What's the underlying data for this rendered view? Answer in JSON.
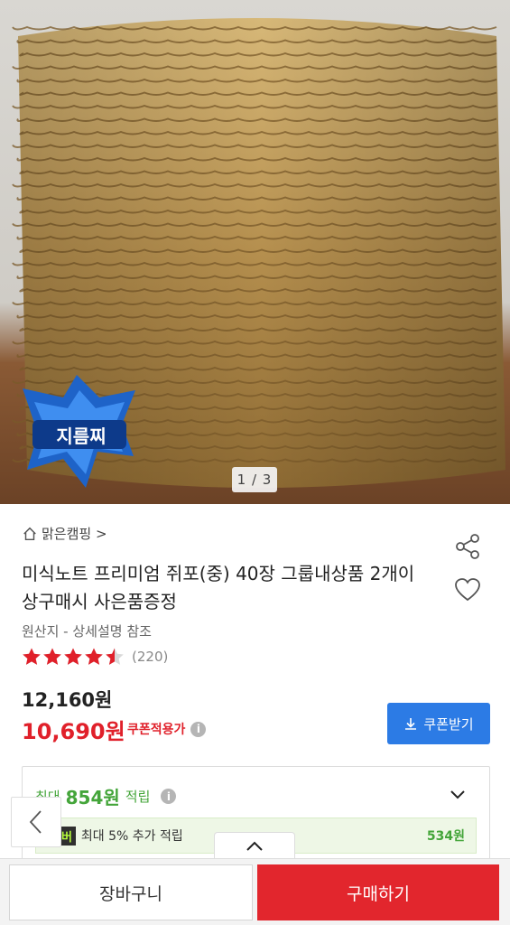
{
  "gallery": {
    "page_indicator": "1 / 3",
    "badge_text": "지름찌"
  },
  "seller": {
    "name": "맑은캠핑 >",
    "icon": "home-icon"
  },
  "product": {
    "title": "미식노트 프리미엄 쥐포(중) 40장 그룹내상품 2개이상구매시 사은품증정",
    "origin": "원산지 - 상세설명 참조",
    "rating": 4.5,
    "review_count": "(220)",
    "original_price": "12,160원",
    "sale_price": "10,690원",
    "coupon_applied_label": "쿠폰적용가"
  },
  "coupon_button": {
    "label": "쿠폰받기",
    "icon": "download-icon"
  },
  "points": {
    "prefix": "최대",
    "value": "854원",
    "suffix": "적립",
    "member_badge": "멤버",
    "member_text": "최대 5% 추가 적립",
    "member_amount": "534원"
  },
  "bottom_bar": {
    "cart_label": "장바구니",
    "buy_label": "구매하기"
  },
  "colors": {
    "accent_red": "#e0202a",
    "coupon_blue": "#2c7be5",
    "points_green": "#44a53a"
  }
}
